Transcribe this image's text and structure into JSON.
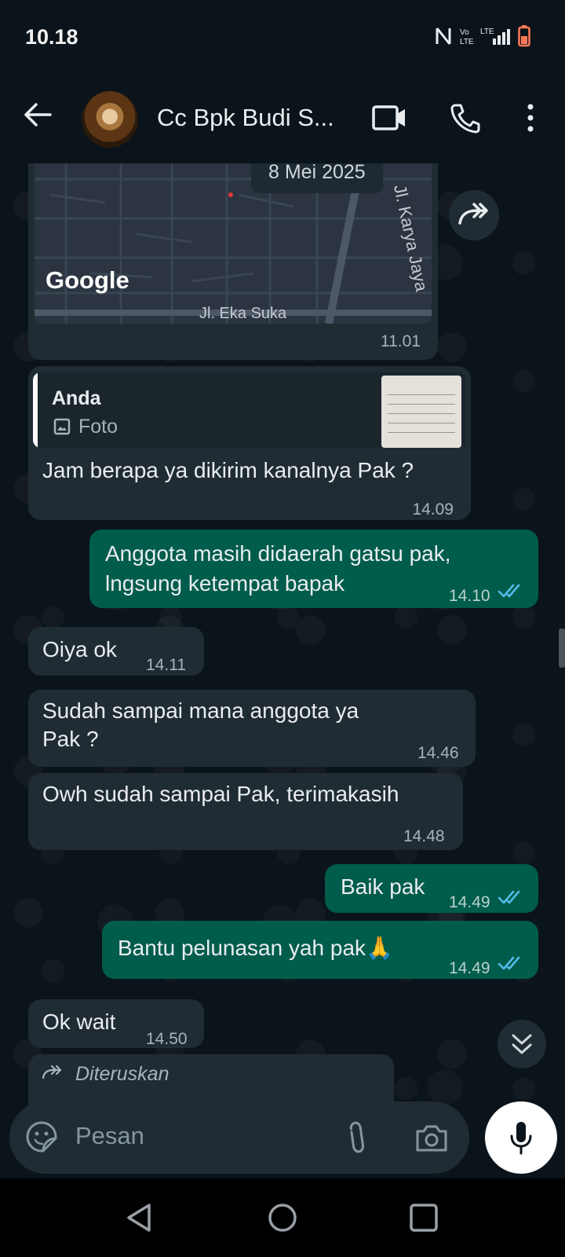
{
  "status_bar": {
    "time": "10.18"
  },
  "header": {
    "title": "Cc Bpk Budi S..."
  },
  "map_message": {
    "date_chip": "8 Mei 2025",
    "google_label": "Google",
    "street_bottom": "Jl. Eka Suka",
    "street_right": "Jl. Karya Jaya",
    "time": "11.01"
  },
  "reply_message": {
    "quoted_name": "Anda",
    "quoted_type": "Foto",
    "text": "Jam berapa ya dikirim kanalnya Pak ?",
    "time": "14.09"
  },
  "messages": [
    {
      "dir": "out",
      "line1": "Anggota masih didaerah gatsu pak,",
      "line2": "lngsung ketempat bapak",
      "time": "14.10"
    },
    {
      "dir": "in",
      "text": "Oiya ok",
      "time": "14.11"
    },
    {
      "dir": "in",
      "line1": "Sudah sampai mana anggota ya",
      "line2": "Pak ?",
      "time": "14.46"
    },
    {
      "dir": "in",
      "text": "Owh sudah sampai Pak, terimakasih",
      "time": "14.48"
    },
    {
      "dir": "out",
      "text": "Baik pak",
      "time": "14.49"
    },
    {
      "dir": "out",
      "text": "Bantu pelunasan yah pak🙏",
      "time": "14.49"
    },
    {
      "dir": "in",
      "text": "Ok wait",
      "time": "14.50"
    },
    {
      "dir": "in",
      "forwarded_label": "Diteruskan"
    }
  ],
  "composer": {
    "placeholder": "Pesan"
  },
  "colors": {
    "incoming": "#202c33",
    "outgoing": "#005c4b",
    "read_ticks": "#53bdeb",
    "background": "#0b141a"
  }
}
